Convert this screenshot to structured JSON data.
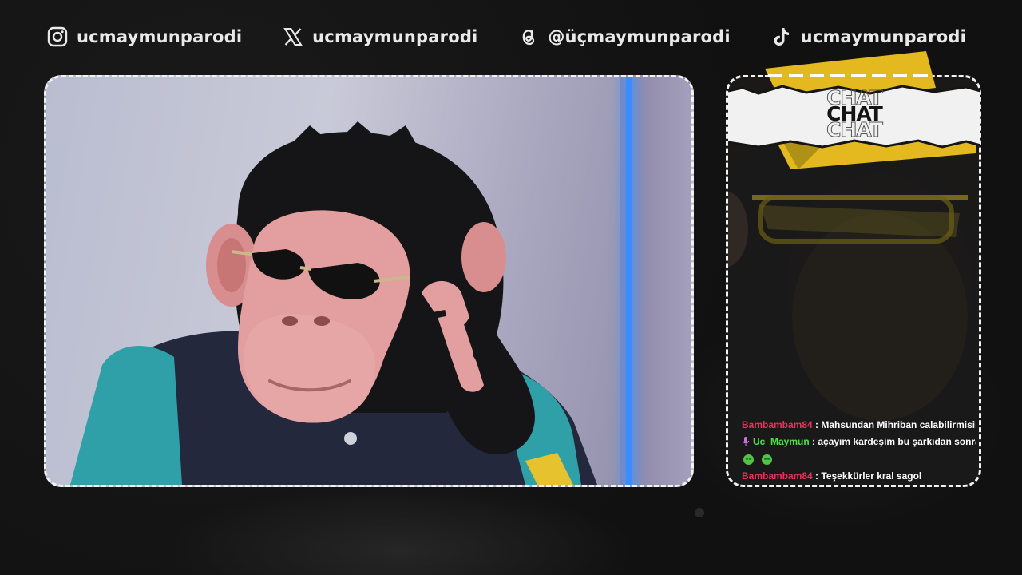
{
  "socials": [
    {
      "icon": "instagram-icon",
      "handle": "ucmaymunparodi"
    },
    {
      "icon": "x-icon",
      "handle": "ucmaymunparodi"
    },
    {
      "icon": "threads-icon",
      "handle": "@üçmaymunparodi"
    },
    {
      "icon": "tiktok-icon",
      "handle": "ucmaymunparodi"
    }
  ],
  "chat": {
    "title": "CHAT",
    "messages": [
      {
        "user": "Bambambam84",
        "user_color": "#e8315a",
        "sep": " : ",
        "text": "Mahsundan Mihriban calabilirmisiniz rica etsem"
      },
      {
        "user": "Uc_Maymun",
        "user_color": "#4be04b",
        "sep": " : ",
        "text": "açayım kardeşim bu şarkıdan sonra.sevdiklerinden"
      },
      {
        "user": "Bambambam84",
        "user_color": "#e8315a",
        "sep": " : ",
        "text": "Teşekkürler kral sagol"
      }
    ]
  },
  "colors": {
    "accent_yellow": "#e3b91f",
    "neon_blue": "#3d8cff"
  }
}
